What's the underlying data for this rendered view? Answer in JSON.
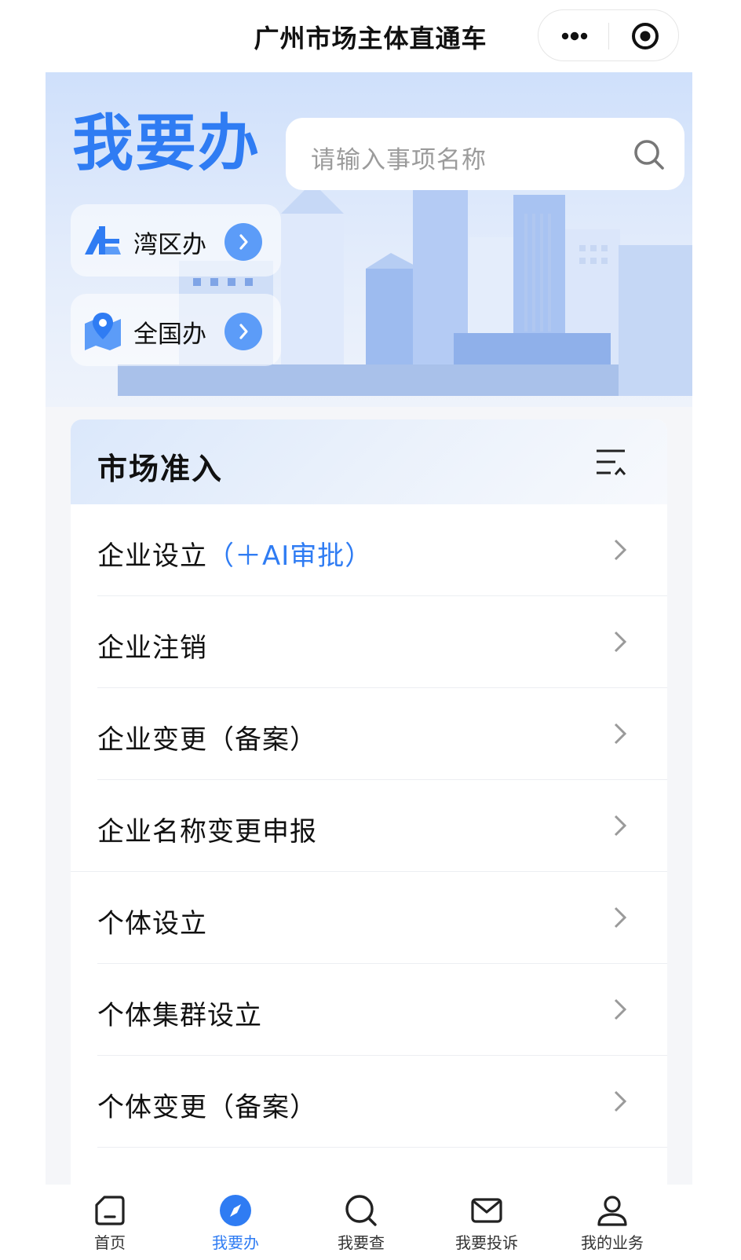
{
  "app": {
    "title": "广州市场主体直通车"
  },
  "hero": {
    "title": "我要办",
    "search_placeholder": "请输入事项名称",
    "shortcuts": [
      {
        "label": "湾区办",
        "icon": "bay-area-logo-icon"
      },
      {
        "label": "全国办",
        "icon": "map-pin-icon"
      }
    ]
  },
  "section": {
    "title": "市场准入",
    "items": [
      {
        "label": "企业设立",
        "highlight": "（＋AI审批）"
      },
      {
        "label": "企业注销"
      },
      {
        "label": "企业变更（备案）"
      },
      {
        "label": "企业名称变更申报"
      },
      {
        "label": "个体设立"
      },
      {
        "label": "个体集群设立"
      },
      {
        "label": "个体变更（备案）"
      }
    ]
  },
  "tabs": [
    {
      "label": "首页",
      "icon": "home-icon"
    },
    {
      "label": "我要办",
      "icon": "compass-icon",
      "active": true
    },
    {
      "label": "我要查",
      "icon": "search-icon"
    },
    {
      "label": "我要投诉",
      "icon": "mail-icon"
    },
    {
      "label": "我的业务",
      "icon": "user-icon"
    }
  ],
  "colors": {
    "accent": "#2f7cf3",
    "panel": "#f5f6f9"
  }
}
